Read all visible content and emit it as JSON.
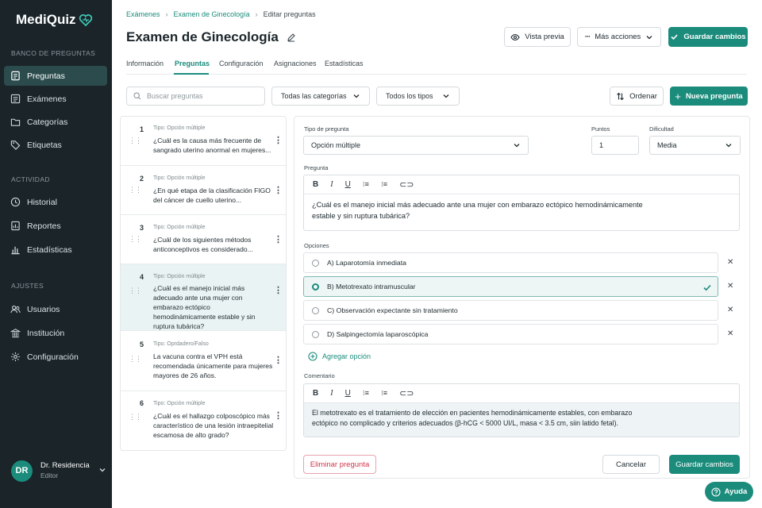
{
  "brand": {
    "name": "MediQuiz",
    "accent": "#1b8c7c",
    "sidebar_bg": "#1a2429"
  },
  "sidebar": {
    "sections": [
      {
        "title": "BANCO DE PREGUNTAS",
        "items": [
          {
            "label": "Preguntas",
            "icon": "document-icon",
            "active": true
          },
          {
            "label": "Exámenes",
            "icon": "exam-icon"
          },
          {
            "label": "Categorías",
            "icon": "folder-icon"
          },
          {
            "label": "Etiquetas",
            "icon": "tag-icon"
          }
        ]
      },
      {
        "title": "ACTIVIDAD",
        "items": [
          {
            "label": "Historial",
            "icon": "clock-icon"
          },
          {
            "label": "Reportes",
            "icon": "report-icon"
          },
          {
            "label": "Estadísticas",
            "icon": "bar-chart-icon"
          }
        ]
      },
      {
        "title": "AJUSTES",
        "items": [
          {
            "label": "Usuarios",
            "icon": "users-icon"
          },
          {
            "label": "Institución",
            "icon": "institution-icon"
          },
          {
            "label": "Configuración",
            "icon": "gear-icon"
          }
        ]
      }
    ],
    "user": {
      "initials": "DR",
      "name": "Dr. Residencia",
      "role": "Editor"
    }
  },
  "breadcrumb": {
    "items": [
      "Exámenes",
      "Examen de Ginecología"
    ],
    "current": "Editar preguntas"
  },
  "page_title": "Examen de Ginecología",
  "header_actions": {
    "preview": "Vista previa",
    "more": "Más acciones",
    "save": "Guardar cambios"
  },
  "tabs": [
    "Información",
    "Preguntas",
    "Configuración",
    "Asignaciones",
    "Estadísticas"
  ],
  "active_tab": "Preguntas",
  "toolbar": {
    "search_placeholder": "Buscar preguntas",
    "category_filter": "Todas las categorías",
    "type_filter": "Todos los tipos",
    "sort": "Ordenar",
    "new_question": "Nueva pregunta"
  },
  "questions": [
    {
      "num": "1",
      "type": "Tipo: Opción múltiple",
      "text": "¿Cuál es la causa más frecuente de sangrado uterino anormal en mujeres..."
    },
    {
      "num": "2",
      "type": "Tipo: Opción múltiple",
      "text": "¿En qué etapa de la clasificación FIGO del cáncer de cuello uterino..."
    },
    {
      "num": "3",
      "type": "Tipo: Opción múltiple",
      "text": "¿Cuál de los siguientes métodos anticonceptivos es considerado..."
    },
    {
      "num": "4",
      "type": "Tipo: Opción múltiple",
      "text": "¿Cuál es el manejo inicial más adecuado ante una mujer con embarazo ectópico hemodinámicamente estable y sin ruptura tubárica?",
      "selected": true
    },
    {
      "num": "5",
      "type": "Tipo: Oprdadero/Falso",
      "text": "La vacuna contra el VPH está recomendada únicamente para mujeres mayores de 26 años."
    },
    {
      "num": "6",
      "type": "Tipo: Opción múltiple",
      "text": "¿Cuál es el hallazgo colposcópico más característico de una lesión intraepitelial escamosa de alto grado?"
    }
  ],
  "editor": {
    "type_label": "Tipo de pregunta",
    "type_value": "Opción múltiple",
    "points_label": "Puntos",
    "points_value": "1",
    "difficulty_label": "Dificultad",
    "difficulty_value": "Media",
    "question_label": "Pregunta",
    "question_text": "¿Cuál es el manejo inicial más adecuado ante una mujer con embarazo ectópico hemodinámicamente estable y sin ruptura tubárica?",
    "options_label": "Opciones",
    "options": [
      {
        "text": "A) Laparotomía inmediata",
        "correct": false
      },
      {
        "text": "B) Metotrexato intramuscular",
        "correct": true
      },
      {
        "text": "C) Observación expectante sin tratamiento",
        "correct": false
      },
      {
        "text": "D) Salpingectomía laparoscópica",
        "correct": false
      }
    ],
    "add_option": "Agregar opción",
    "comment_label": "Comentario",
    "comment_text": "El metotrexato es el tratamiento de elección en pacientes hemodinámicamente estables, con embarazo ectópico no complicado y criterios adecuados (β-hCG < 5000 UI/L, masa < 3.5 cm, siin latido fetal).",
    "delete": "Eliminar pregunta",
    "cancel": "Cancelar",
    "save": "Guardar cambios"
  },
  "help": "Ayuda"
}
